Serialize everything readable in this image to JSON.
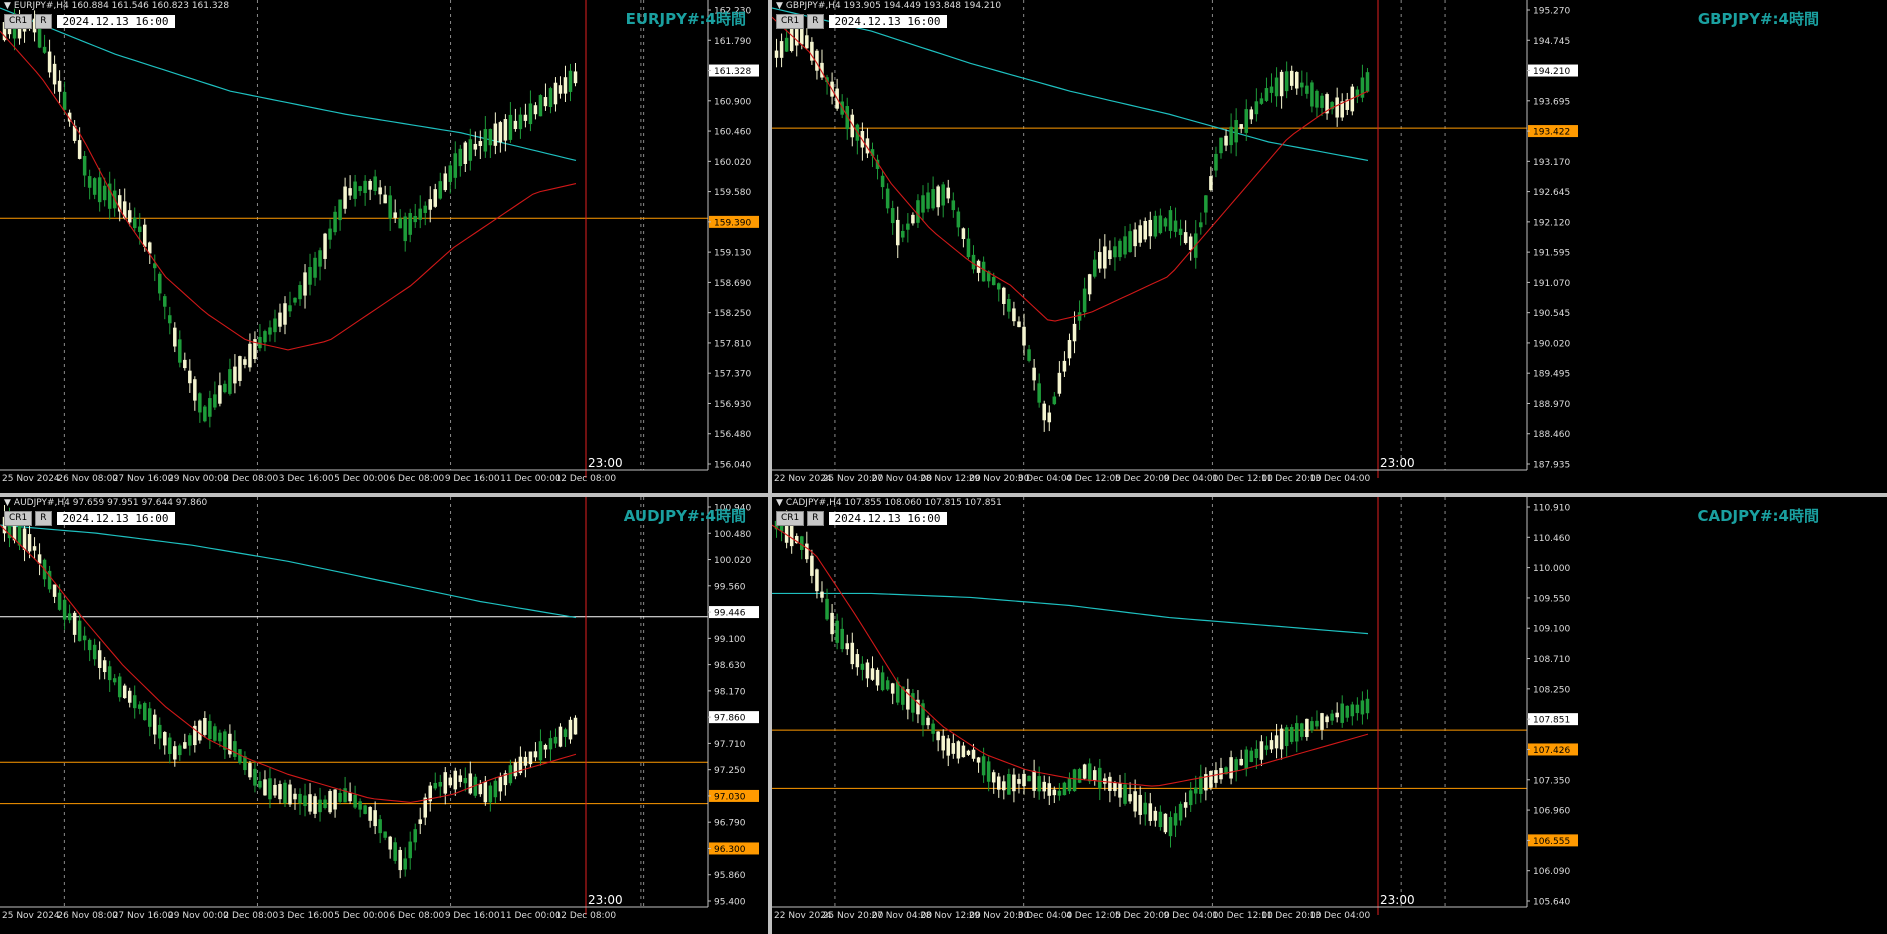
{
  "colors": {
    "background": "#000000",
    "bull_candle": "#f5f5d0",
    "bear_candle": "#1e9c3a",
    "ma_fast": "#d01818",
    "ma_slow": "#1ec0c0",
    "hline": "#ff9a00",
    "vline_now": "#e02020",
    "symbol_text": "#1aa0a0",
    "price_box": "#ff9a00"
  },
  "toolbar": {
    "cr1_label": "CR1",
    "r_label": "R"
  },
  "panels": [
    {
      "id": "eurjpy",
      "header": "EURJPY#,H4  160.884 161.546 160.823 161.328",
      "symbol_label": "EURJPY#:4時間",
      "date_box": "2024.12.13 16:00",
      "time_marker": "23:00",
      "price_ticks": [
        "162.230",
        "161.790",
        "161.328",
        "160.900",
        "160.460",
        "160.020",
        "159.580",
        "159.390",
        "159.130",
        "158.690",
        "158.250",
        "157.810",
        "157.370",
        "156.930",
        "156.480",
        "156.040"
      ],
      "current_price": "161.328",
      "hline_labels": [
        "159.390"
      ],
      "x_ticks": [
        "25 Nov 2024",
        "26 Nov 08:00",
        "27 Nov 16:00",
        "29 Nov 00:00",
        "2 Dec 08:00",
        "3 Dec 16:00",
        "5 Dec 00:00",
        "6 Dec 08:00",
        "9 Dec 16:00",
        "11 Dec 00:00",
        "12 Dec 08:00"
      ]
    },
    {
      "id": "gbpjpy",
      "header": "GBPJPY#,H4  193.905 194.449 193.848 194.210",
      "symbol_label": "GBPJPY#:4時間",
      "date_box": "2024.12.13 16:00",
      "time_marker": "23:00",
      "price_ticks": [
        "195.270",
        "194.745",
        "194.210",
        "193.695",
        "193.422",
        "193.170",
        "192.645",
        "192.120",
        "191.595",
        "191.070",
        "190.545",
        "190.020",
        "189.495",
        "188.970",
        "188.460",
        "187.935"
      ],
      "current_price": "194.210",
      "hline_labels": [
        "193.422"
      ],
      "x_ticks": [
        "22 Nov 2024",
        "25 Nov 20:00",
        "27 Nov 04:00",
        "28 Nov 12:00",
        "29 Nov 20:00",
        "3 Dec 04:00",
        "4 Dec 12:00",
        "5 Dec 20:00",
        "9 Dec 04:00",
        "10 Dec 12:00",
        "11 Dec 20:00",
        "13 Dec 04:00"
      ]
    },
    {
      "id": "audjpy",
      "header": "AUDJPY#,H4  97.659 97.951 97.644 97.860",
      "symbol_label": "AUDJPY#:4時間",
      "date_box": "2024.12.13 16:00",
      "time_marker": "23:00",
      "price_ticks": [
        "100.940",
        "100.480",
        "100.020",
        "99.560",
        "99.446",
        "99.100",
        "98.630",
        "98.170",
        "97.860",
        "97.710",
        "97.250",
        "97.030",
        "96.790",
        "96.300",
        "95.860",
        "95.400"
      ],
      "current_price": "97.860",
      "hline_labels": [
        "99.446",
        "97.030",
        "96.300"
      ],
      "x_ticks": [
        "25 Nov 2024",
        "26 Nov 08:00",
        "27 Nov 16:00",
        "29 Nov 00:00",
        "2 Dec 08:00",
        "3 Dec 16:00",
        "5 Dec 00:00",
        "6 Dec 08:00",
        "9 Dec 16:00",
        "11 Dec 00:00",
        "12 Dec 08:00"
      ]
    },
    {
      "id": "cadjpy",
      "header": "CADJPY#,H4  107.855 108.060 107.815 107.851",
      "symbol_label": "CADJPY#:4時間",
      "date_box": "2024.12.13 16:00",
      "time_marker": "23:00",
      "price_ticks": [
        "110.910",
        "110.460",
        "110.000",
        "109.550",
        "109.100",
        "108.710",
        "108.250",
        "107.851",
        "107.426",
        "107.350",
        "106.960",
        "106.555",
        "106.090",
        "105.640"
      ],
      "current_price": "107.851",
      "hline_labels": [
        "107.426",
        "106.555"
      ],
      "x_ticks": [
        "22 Nov 2024",
        "25 Nov 20:00",
        "27 Nov 04:00",
        "28 Nov 12:00",
        "29 Nov 20:00",
        "3 Dec 04:00",
        "4 Dec 12:00",
        "5 Dec 20:00",
        "9 Dec 04:00",
        "10 Dec 12:00",
        "11 Dec 20:00",
        "13 Dec 04:00"
      ]
    }
  ]
}
